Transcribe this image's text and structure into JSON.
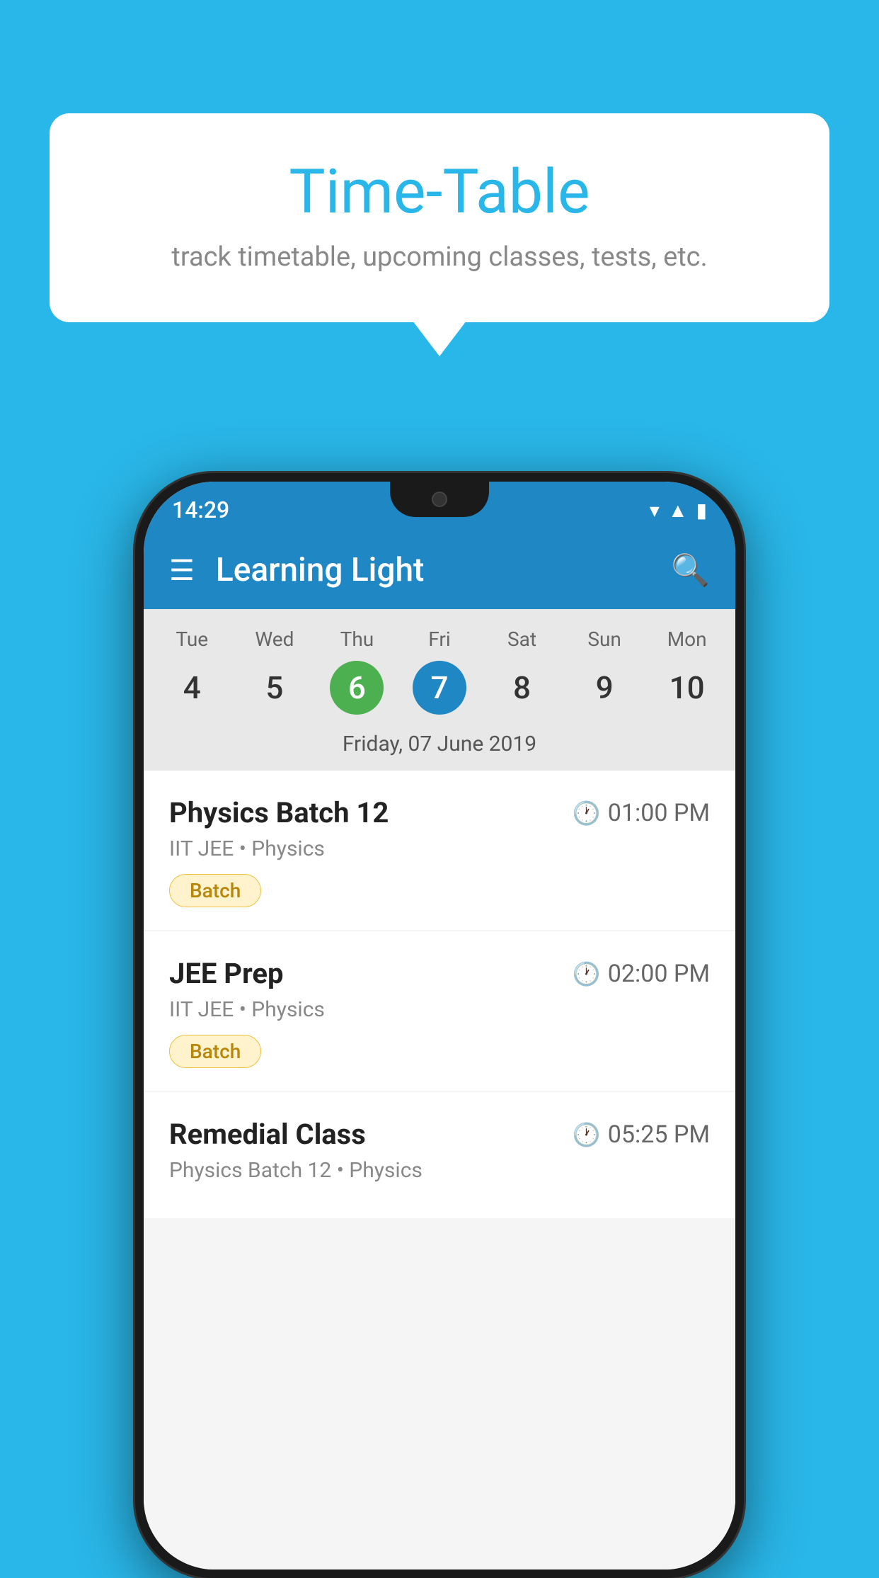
{
  "background_color": "#29b6e8",
  "speech_bubble": {
    "title": "Time-Table",
    "subtitle": "track timetable, upcoming classes, tests, etc."
  },
  "phone": {
    "status_bar": {
      "time": "14:29",
      "icons": [
        "wifi",
        "signal",
        "battery"
      ]
    },
    "app_bar": {
      "title": "Learning Light",
      "menu_icon": "☰",
      "search_icon": "🔍"
    },
    "calendar": {
      "days": [
        {
          "name": "Tue",
          "num": "4",
          "state": "normal"
        },
        {
          "name": "Wed",
          "num": "5",
          "state": "normal"
        },
        {
          "name": "Thu",
          "num": "6",
          "state": "today"
        },
        {
          "name": "Fri",
          "num": "7",
          "state": "selected"
        },
        {
          "name": "Sat",
          "num": "8",
          "state": "normal"
        },
        {
          "name": "Sun",
          "num": "9",
          "state": "normal"
        },
        {
          "name": "Mon",
          "num": "10",
          "state": "normal"
        }
      ],
      "selected_date_label": "Friday, 07 June 2019"
    },
    "schedule": [
      {
        "title": "Physics Batch 12",
        "time": "01:00 PM",
        "subtitle": "IIT JEE • Physics",
        "badge": "Batch"
      },
      {
        "title": "JEE Prep",
        "time": "02:00 PM",
        "subtitle": "IIT JEE • Physics",
        "badge": "Batch"
      },
      {
        "title": "Remedial Class",
        "time": "05:25 PM",
        "subtitle": "Physics Batch 12 • Physics",
        "badge": null
      }
    ]
  }
}
